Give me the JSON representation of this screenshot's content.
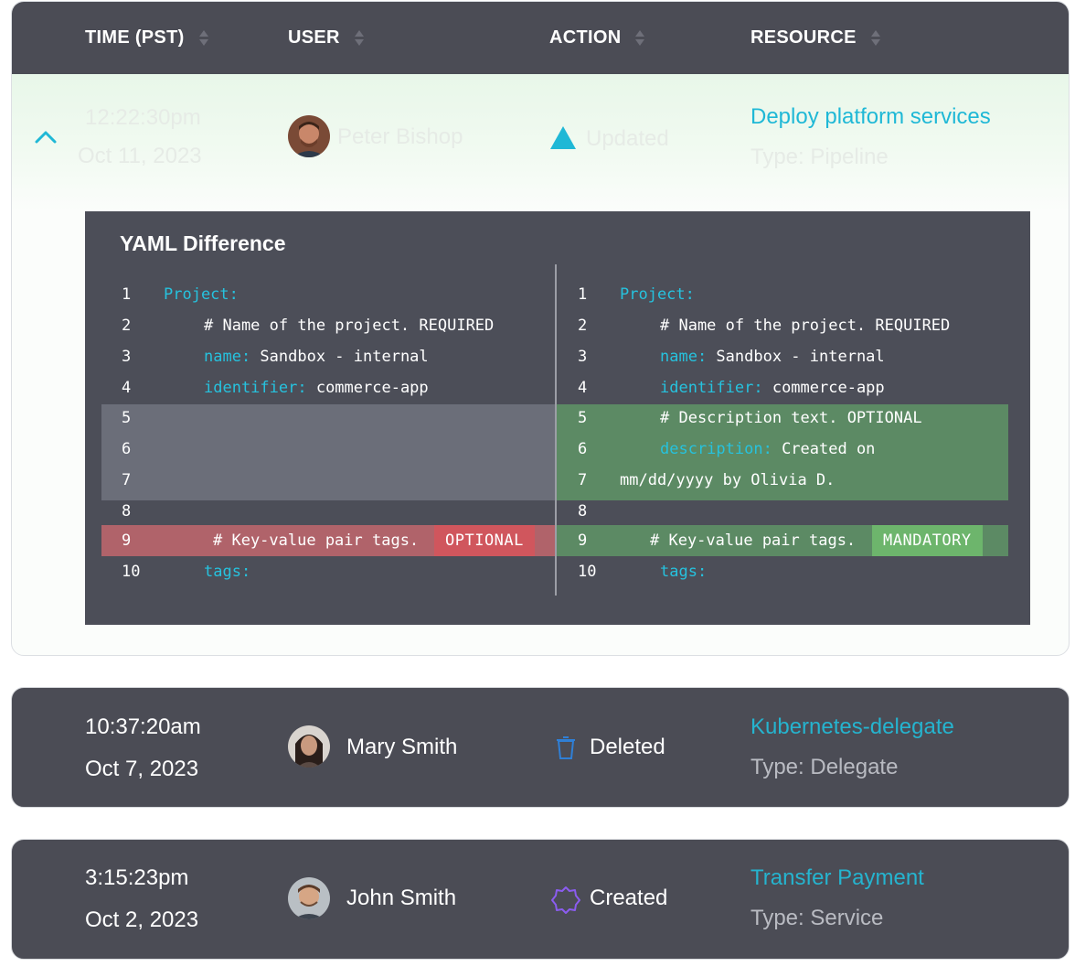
{
  "table_header": {
    "columns": [
      "TIME (PST)",
      "USER",
      "ACTION",
      "RESOURCE"
    ]
  },
  "expanded_row": {
    "time": "12:22:30pm",
    "date": "Oct 11, 2023",
    "user": "Peter Bishop",
    "action": "Updated",
    "resource_name": "Deploy platform services",
    "resource_type": "Type: Pipeline",
    "accent_color": "#1fb8d6"
  },
  "yaml_diff": {
    "title": "YAML Difference",
    "left": {
      "lines": [
        {
          "n": "1",
          "key": "Project:",
          "text": ""
        },
        {
          "n": "2",
          "key": "",
          "text": "# Name of the project. REQUIRED"
        },
        {
          "n": "3",
          "key": "name:",
          "text": " Sandbox - internal"
        },
        {
          "n": "4",
          "key": "identifier:",
          "text": " commerce-app"
        },
        {
          "n": "5",
          "key": "",
          "text": ""
        },
        {
          "n": "6",
          "key": "",
          "text": ""
        },
        {
          "n": "7",
          "key": "",
          "text": ""
        },
        {
          "n": "8",
          "key": "",
          "text": ""
        },
        {
          "n": "9",
          "key": "",
          "text": "# Key-value pair tags."
        },
        {
          "n": "10",
          "key": "tags:",
          "text": ""
        }
      ],
      "badge": "OPTIONAL",
      "badge_color": "#d0565d"
    },
    "right": {
      "lines": [
        {
          "n": "1",
          "key": "Project:",
          "text": ""
        },
        {
          "n": "2",
          "key": "",
          "text": "# Name of the project. REQUIRED"
        },
        {
          "n": "3",
          "key": "name:",
          "text": " Sandbox - internal"
        },
        {
          "n": "4",
          "key": "identifier:",
          "text": " commerce-app"
        },
        {
          "n": "5",
          "key": "",
          "text": "# Description text. OPTIONAL"
        },
        {
          "n": "6",
          "key": "description:",
          "text": " Created on"
        },
        {
          "n": "7",
          "key": "",
          "text": "mm/dd/yyyy by Olivia D."
        },
        {
          "n": "8",
          "key": "",
          "text": ""
        },
        {
          "n": "9",
          "key": "",
          "text": "# Key-value pair tags."
        },
        {
          "n": "10",
          "key": "tags:",
          "text": ""
        }
      ],
      "badge": "MANDATORY",
      "badge_color": "#6db56c"
    }
  },
  "rows": [
    {
      "time": "10:37:20am",
      "date": "Oct 7, 2023",
      "user": "Mary Smith",
      "action": "Deleted",
      "action_icon": "trash-icon",
      "resource_name": "Kubernetes-delegate",
      "resource_type": "Type: Delegate"
    },
    {
      "time": "3:15:23pm",
      "date": "Oct 2, 2023",
      "user": "John Smith",
      "action": "Created",
      "action_icon": "starburst-icon",
      "resource_name": "Transfer Payment",
      "resource_type": "Type: Service"
    }
  ]
}
